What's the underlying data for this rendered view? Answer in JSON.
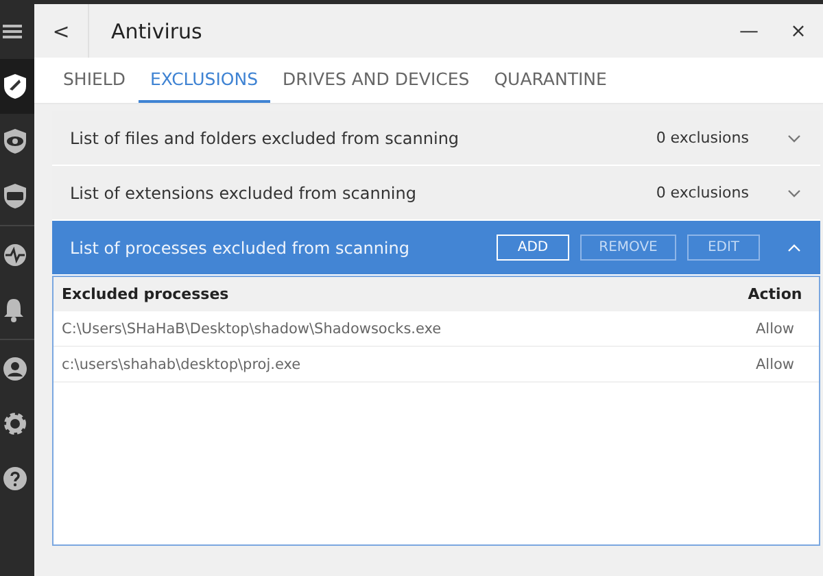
{
  "sidebar": {
    "groups": [
      {
        "items": [
          {
            "kind": "menu",
            "selected": false
          },
          {
            "kind": "shield",
            "selected": true
          },
          {
            "kind": "eye",
            "selected": false
          },
          {
            "kind": "tv",
            "selected": false
          }
        ]
      },
      {
        "items": [
          {
            "kind": "pulse",
            "selected": false
          },
          {
            "kind": "bell",
            "selected": false
          }
        ]
      },
      {
        "items": [
          {
            "kind": "user",
            "selected": false
          },
          {
            "kind": "gear",
            "selected": false
          },
          {
            "kind": "help",
            "selected": false
          }
        ]
      }
    ]
  },
  "window": {
    "back": "<",
    "title": "Antivirus",
    "minimize": "—",
    "close": "×"
  },
  "tabs": [
    {
      "label": "SHIELD",
      "selected": false
    },
    {
      "label": "EXCLUSIONS",
      "selected": true
    },
    {
      "label": "DRIVES AND DEVICES",
      "selected": false
    },
    {
      "label": "QUARANTINE",
      "selected": false
    }
  ],
  "sections": [
    {
      "title": "List of files and folders excluded from scanning",
      "count": "0 exclusions",
      "expanded": false
    },
    {
      "title": "List of extensions excluded from scanning",
      "count": "0 exclusions",
      "expanded": false
    },
    {
      "title": "List of processes excluded from scanning",
      "expanded": true,
      "buttons": [
        {
          "label": "ADD",
          "disabled": false
        },
        {
          "label": "REMOVE",
          "disabled": true
        },
        {
          "label": "EDIT",
          "disabled": true
        }
      ],
      "table": {
        "columns": [
          "Excluded processes",
          "Action"
        ],
        "rows": [
          [
            "C:\\Users\\SHaHaB\\Desktop\\shadow\\Shadowsocks.exe",
            "Allow"
          ],
          [
            "c:\\users\\shahab\\desktop\\proj.exe",
            "Allow"
          ]
        ]
      }
    }
  ]
}
